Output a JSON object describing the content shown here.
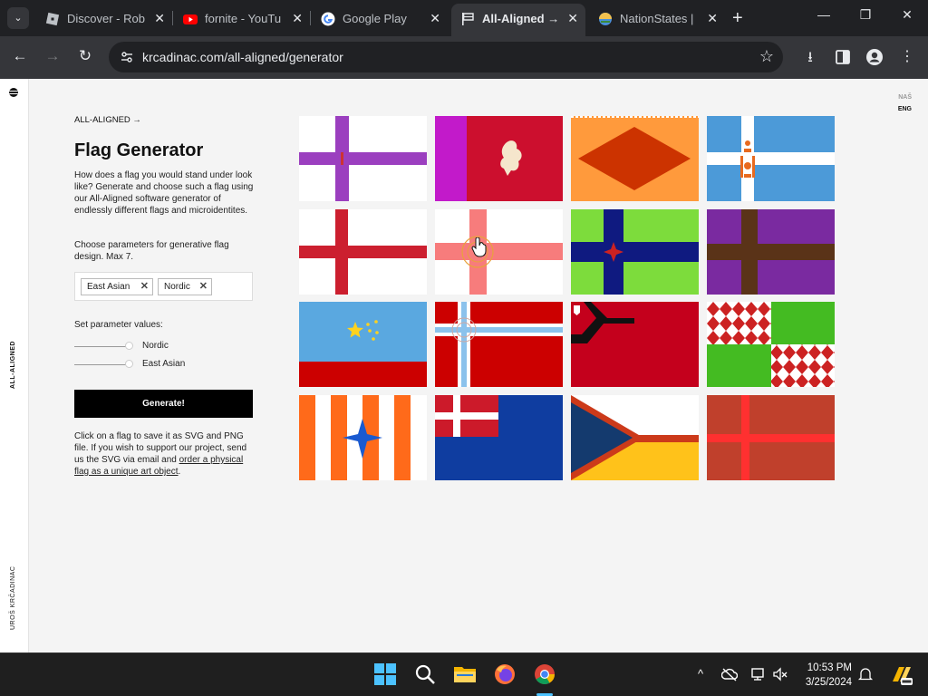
{
  "browser": {
    "tabs": [
      {
        "title": "Discover - Rob",
        "icon": "roblox-icon",
        "active": false
      },
      {
        "title": "fornite - YouTu",
        "icon": "youtube-icon",
        "active": false
      },
      {
        "title": "Google Play",
        "icon": "google-icon",
        "active": false
      },
      {
        "title": "All-Aligned → ",
        "icon": "flag-icon",
        "active": true
      },
      {
        "title": "NationStates |",
        "icon": "nationstates-icon",
        "active": false
      }
    ],
    "url": "krcadinac.com/all-aligned/generator"
  },
  "page": {
    "side_label_top": "ALL-ALIGNED",
    "side_label_bottom": "UROŠ KRČADINAC",
    "lang": {
      "nas": "NAŠ",
      "eng": "ENG"
    },
    "brand": "ALL-ALIGNED →",
    "title": "Flag Generator",
    "intro": "How does a flag you would stand under look like? Generate and choose such a flag using our All-Aligned software generator of endlessly different flags and microidentites.",
    "choose_text": "Choose parameters for generative flag design. Max 7.",
    "tags": [
      "East Asian",
      "Nordic"
    ],
    "set_values_label": "Set parameter values:",
    "sliders": [
      {
        "label": "Nordic",
        "value": 1.0
      },
      {
        "label": "East Asian",
        "value": 1.0
      }
    ],
    "generate_label": "Generate!",
    "footer_text": "Click on a flag to save it as SVG and PNG file. If you wish to support our project, send us the SVG via email and ",
    "footer_link": "order a physical flag as a unique art object",
    "footer_end": "."
  },
  "flags": [
    {
      "name": "flag-purple-cross",
      "colors": [
        "#ffffff",
        "#9b3fbf",
        "#cc3333"
      ]
    },
    {
      "name": "flag-lion",
      "colors": [
        "#c21aca",
        "#cc0f2e",
        "#f5e6cc"
      ]
    },
    {
      "name": "flag-orange-diamond",
      "colors": [
        "#ff9a3c",
        "#cc3300"
      ]
    },
    {
      "name": "flag-blue-soyombo",
      "colors": [
        "#4c9ad8",
        "#ffffff",
        "#e86a1f"
      ]
    },
    {
      "name": "flag-red-cross",
      "colors": [
        "#ffffff",
        "#cc1f2f"
      ]
    },
    {
      "name": "flag-pink-cross-emblem",
      "colors": [
        "#ffffff",
        "#f77c7c",
        "#e8a23c"
      ]
    },
    {
      "name": "flag-green-blue-cross",
      "colors": [
        "#7ddc3c",
        "#0f1a80",
        "#cc2222"
      ]
    },
    {
      "name": "flag-purple-brown-cross",
      "colors": [
        "#7a2aa0",
        "#5a3318"
      ]
    },
    {
      "name": "flag-blue-stars",
      "colors": [
        "#5aa8e0",
        "#cc0000",
        "#ffd21f"
      ]
    },
    {
      "name": "flag-red-blue-cross",
      "colors": [
        "#cc0000",
        "#8bc2ec",
        "#ffffff"
      ]
    },
    {
      "name": "flag-red-black-chevron",
      "colors": [
        "#c4001c",
        "#111111",
        "#ffffff"
      ]
    },
    {
      "name": "flag-checker-green",
      "colors": [
        "#ffffff",
        "#cc2222",
        "#44bb22"
      ]
    },
    {
      "name": "flag-orange-stripes-star",
      "colors": [
        "#ff6a1a",
        "#ffffff",
        "#1a5ad0"
      ]
    },
    {
      "name": "flag-dannebrog-blue",
      "colors": [
        "#cc1a2a",
        "#ffffff",
        "#0f3da0"
      ]
    },
    {
      "name": "flag-blue-chevron-yellow",
      "colors": [
        "#143a6e",
        "#ffc21a",
        "#cc3a1a"
      ]
    },
    {
      "name": "flag-brown-red-cross",
      "colors": [
        "#c0402c",
        "#ff3030"
      ]
    }
  ],
  "taskbar": {
    "time": "10:53 PM",
    "date": "3/25/2024"
  }
}
